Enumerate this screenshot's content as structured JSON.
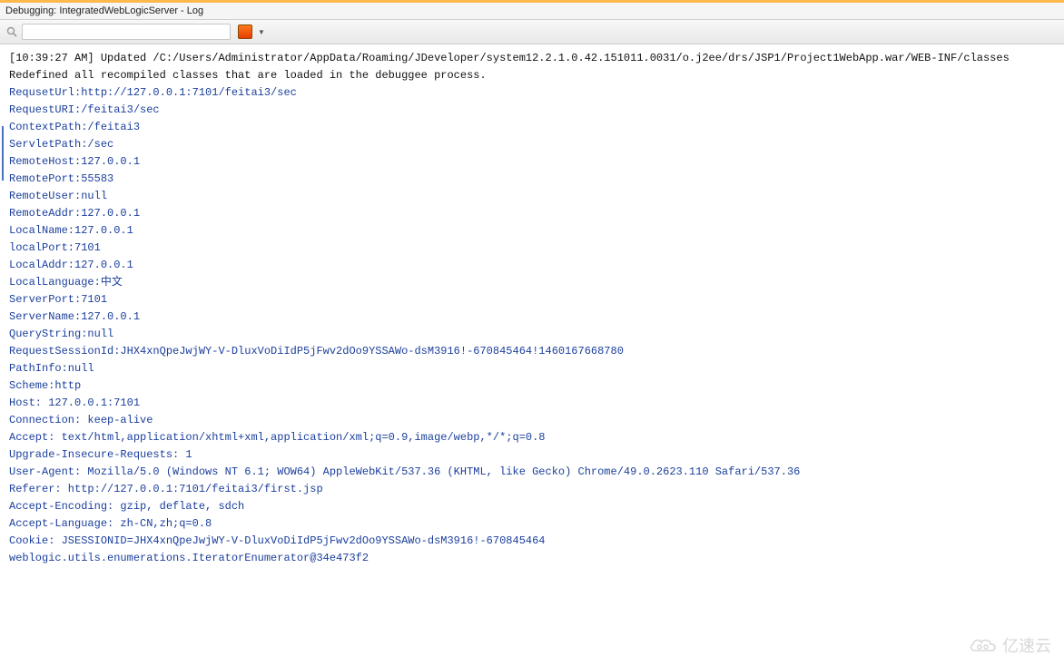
{
  "panel": {
    "title": "Debugging: IntegratedWebLogicServer - Log"
  },
  "search": {
    "value": "",
    "placeholder": ""
  },
  "log": {
    "line1": "[10:39:27 AM] Updated /C:/Users/Administrator/AppData/Roaming/JDeveloper/system12.2.1.0.42.151011.0031/o.j2ee/drs/JSP1/Project1WebApp.war/WEB-INF/classes",
    "line2": "Redefined all recompiled classes that are loaded in the debuggee process.",
    "blue": [
      "RequsetUrl:http://127.0.0.1:7101/feitai3/sec",
      "RequestURI:/feitai3/sec",
      "ContextPath:/feitai3",
      "ServletPath:/sec",
      "RemoteHost:127.0.0.1",
      "RemotePort:55583",
      "RemoteUser:null",
      "RemoteAddr:127.0.0.1",
      "LocalName:127.0.0.1",
      "localPort:7101",
      "LocalAddr:127.0.0.1",
      "LocalLanguage:中文",
      "ServerPort:7101",
      "ServerName:127.0.0.1",
      "QueryString:null",
      "RequestSessionId:JHX4xnQpeJwjWY-V-DluxVoDiIdP5jFwv2dOo9YSSAWo-dsM3916!-670845464!1460167668780",
      "PathInfo:null",
      "Scheme:http",
      "Host: 127.0.0.1:7101",
      "Connection: keep-alive",
      "Accept: text/html,application/xhtml+xml,application/xml;q=0.9,image/webp,*/*;q=0.8",
      "Upgrade-Insecure-Requests: 1",
      "User-Agent: Mozilla/5.0 (Windows NT 6.1; WOW64) AppleWebKit/537.36 (KHTML, like Gecko) Chrome/49.0.2623.110 Safari/537.36",
      "Referer: http://127.0.0.1:7101/feitai3/first.jsp",
      "Accept-Encoding: gzip, deflate, sdch",
      "Accept-Language: zh-CN,zh;q=0.8",
      "Cookie: JSESSIONID=JHX4xnQpeJwjWY-V-DluxVoDiIdP5jFwv2dOo9YSSAWo-dsM3916!-670845464",
      "weblogic.utils.enumerations.IteratorEnumerator@34e473f2"
    ]
  },
  "watermark": {
    "text": "亿速云"
  }
}
